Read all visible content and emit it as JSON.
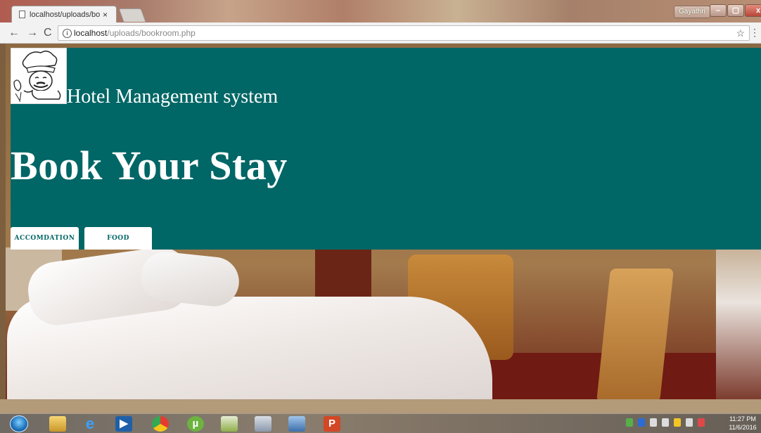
{
  "browser": {
    "tab_title": "localhost/uploads/bookr",
    "tab_close": "×",
    "user": "Gayathri",
    "window_buttons": [
      "–",
      "▢",
      "x"
    ],
    "nav": {
      "back": "←",
      "forward": "→",
      "reload": "C"
    },
    "url_host": "localhost",
    "url_path": "/uploads/bookroom.php",
    "info_glyph": "i",
    "star": "☆",
    "menu": "⋮"
  },
  "page": {
    "site_title": "Hotel Management system",
    "heading": "Book Your Stay",
    "buttons": {
      "accommodation": "ACCOMDATION",
      "food": "FOOD"
    },
    "colors": {
      "header_bg": "#006666",
      "button_text": "#006666"
    }
  },
  "taskbar": {
    "apps": [
      "windows-explorer",
      "internet-explorer",
      "media-player",
      "chrome",
      "utorrent",
      "app-green",
      "paint",
      "monitor",
      "powerpoint"
    ],
    "time": "11:27 PM",
    "date": "11/6/2016"
  }
}
